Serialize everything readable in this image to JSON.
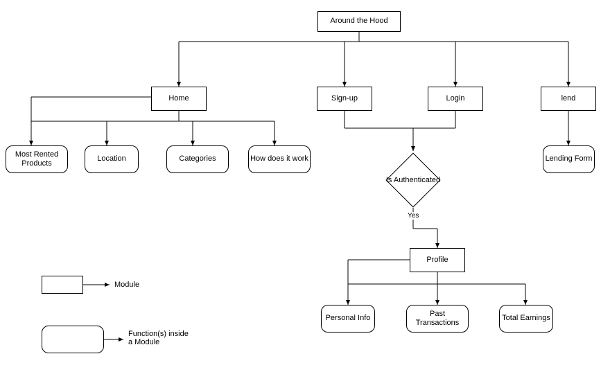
{
  "nodes": {
    "root": "Around the Hood",
    "home": "Home",
    "signup": "Sign-up",
    "login": "Login",
    "lend": "lend",
    "mostRented": "Most Rented Products",
    "location": "Location",
    "categories": "Categories",
    "howWork": "How does it work",
    "isAuth": "Is Authenticated",
    "profile": "Profile",
    "personalInfo": "Personal Info",
    "pastTx": "Past Transactions",
    "totalEarn": "Total Earnings",
    "lendingForm": "Lending Form"
  },
  "edges": {
    "yes": "Yes"
  },
  "legend": {
    "module": "Module",
    "function": "Function(s) inside a Module"
  }
}
